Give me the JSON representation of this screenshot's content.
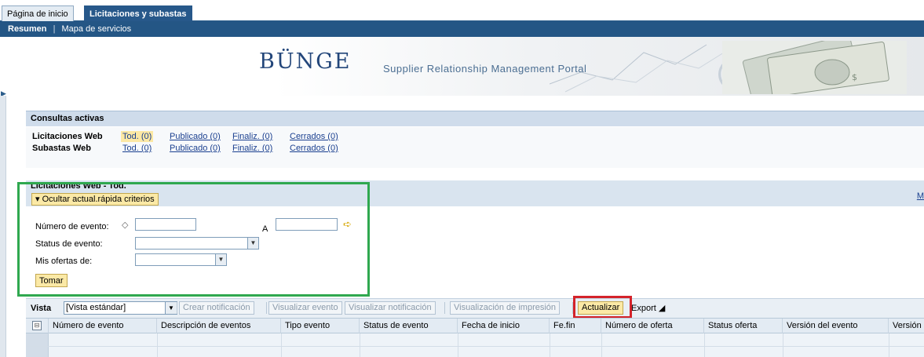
{
  "tabs": [
    "Página de inicio",
    "Licitaciones y subastas"
  ],
  "subnav": {
    "active": "Resumen",
    "separator": "|",
    "other": "Mapa de servicios"
  },
  "banner": {
    "logo": "BÜNGE",
    "portal_title": "Supplier Relationship Management Portal"
  },
  "active_queries": {
    "title": "Consultas activas",
    "rows": [
      {
        "label": "Licitaciones Web",
        "links": [
          "Tod. (0)",
          "Publicado (0)",
          "Finaliz. (0)",
          "Cerrados (0)"
        ]
      },
      {
        "label": "Subastas Web",
        "links": [
          "Tod. (0)",
          "Publicado (0)",
          "Finaliz. (0)",
          "Cerrados (0)"
        ]
      }
    ]
  },
  "list": {
    "title": "Licitaciones Web - Tod.",
    "right_link": "M"
  },
  "criteria": {
    "toggle_label": "Ocultar actual.rápida criterios",
    "event_number_label": "Número de evento:",
    "to_label": "A",
    "event_status_label": "Status de evento:",
    "my_bids_label": "Mis ofertas de:",
    "take_label": "Tomar"
  },
  "toolbar": {
    "view_label": "Vista",
    "view_value": "[Vista estándar]",
    "create_notification": "Crear notificación",
    "show_event": "Visualizar evento",
    "show_notification": "Visualizar notificación",
    "print_view": "Visualización de impresión",
    "refresh": "Actualizar",
    "export": "Export"
  },
  "table": {
    "columns": [
      "Número de evento",
      "Descripción de eventos",
      "Tipo evento",
      "Status de evento",
      "Fecha de inicio",
      "Fe.fin",
      "Número de oferta",
      "Status oferta",
      "Versión del evento",
      "Versión"
    ]
  },
  "colors": {
    "nav_blue": "#245685",
    "header_blue": "#cfdceb",
    "button_yellow": "#fbe9a6",
    "highlight_green": "#2fa84f",
    "highlight_red": "#d4232a"
  },
  "icons": [
    "diamond-icon",
    "arrow-right-icon",
    "dropdown-arrow-icon",
    "select-all-icon",
    "expand-arrow-icon"
  ]
}
